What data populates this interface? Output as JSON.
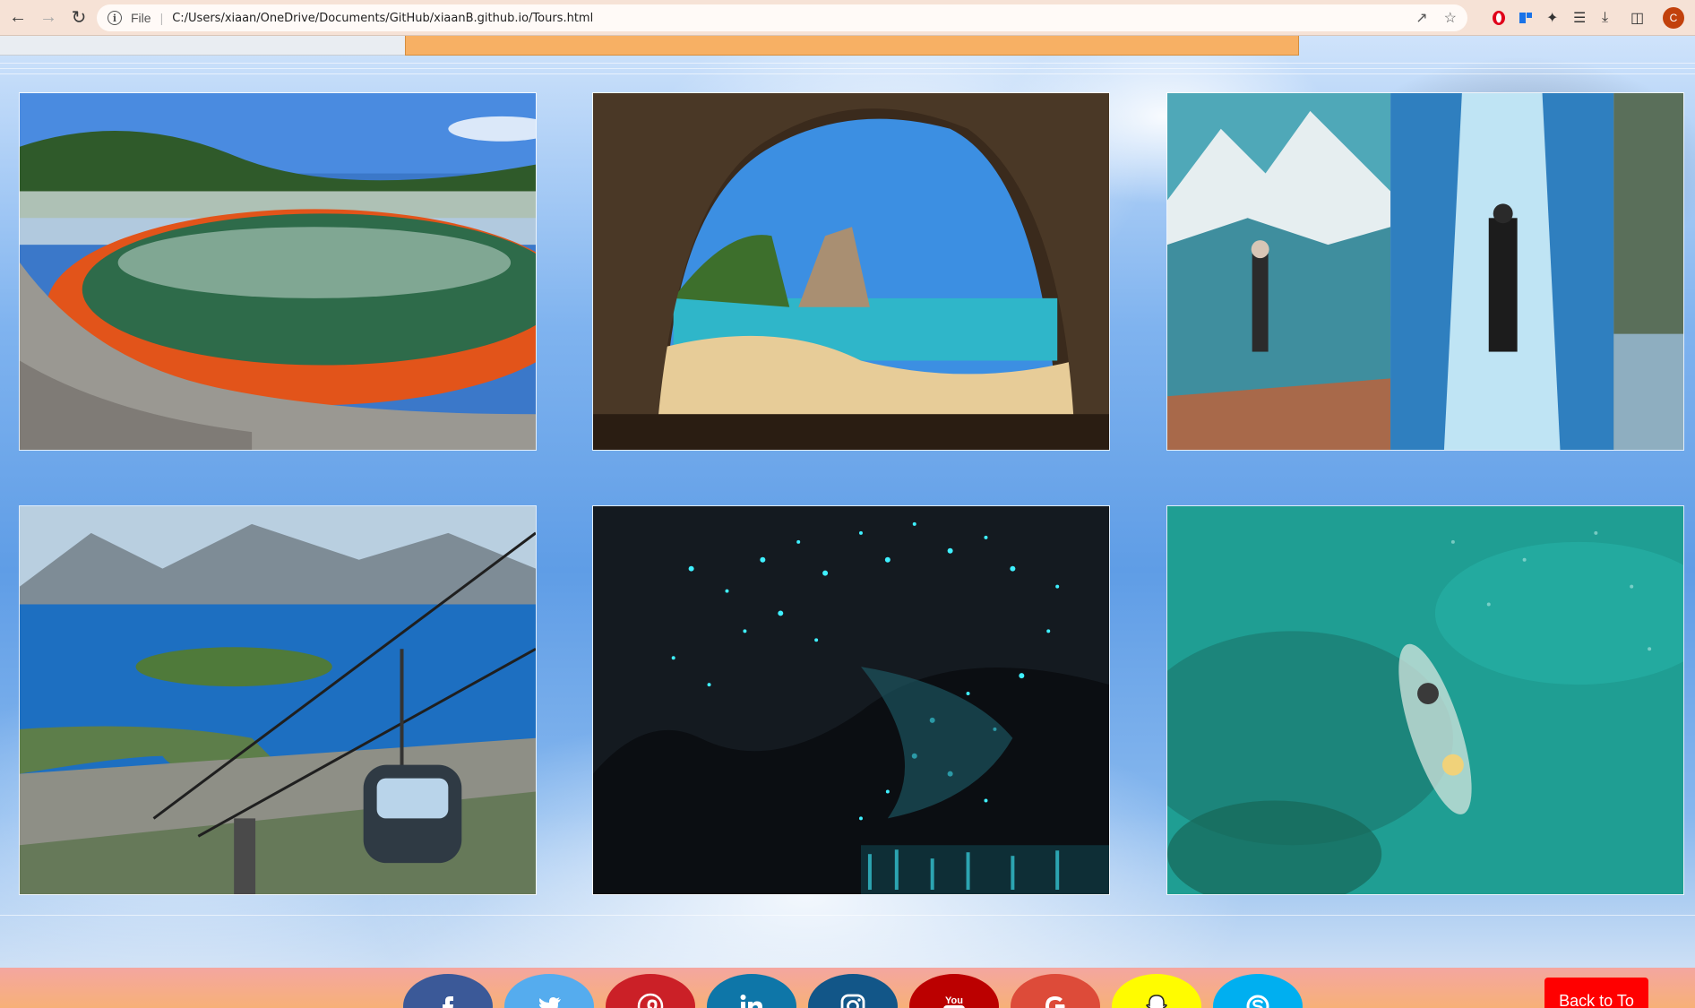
{
  "browser": {
    "scheme_label": "File",
    "url": "C:/Users/xiaan/OneDrive/Documents/GitHub/xiaanB.github.io/Tours.html",
    "profile_initial": "C"
  },
  "gallery": {
    "images": [
      {
        "name": "geothermal-pool-image",
        "subject": "Champagne Pool geothermal lake"
      },
      {
        "name": "cathedral-cove-image",
        "subject": "sea cave arch with beach"
      },
      {
        "name": "glacier-hiking-image",
        "subject": "mountain and ice cave hikers"
      },
      {
        "name": "gondola-lake-image",
        "subject": "gondola over lake town"
      },
      {
        "name": "glowworm-cave-image",
        "subject": "glowworm cave"
      },
      {
        "name": "kayak-lagoon-image",
        "subject": "kayak on turquoise water"
      }
    ]
  },
  "footer": {
    "social": [
      {
        "name": "facebook",
        "color": "#3b5998"
      },
      {
        "name": "twitter",
        "color": "#55acee"
      },
      {
        "name": "pinterest",
        "color": "#cb2027"
      },
      {
        "name": "linkedin",
        "color": "#0e76a8"
      },
      {
        "name": "instagram",
        "color": "#125688"
      },
      {
        "name": "youtube",
        "color": "#bb0000"
      },
      {
        "name": "google",
        "color": "#dd4b39"
      },
      {
        "name": "snapchat",
        "color": "#fffc00"
      },
      {
        "name": "skype",
        "color": "#00aff0"
      }
    ],
    "back_to_top_label": "Back to To"
  }
}
